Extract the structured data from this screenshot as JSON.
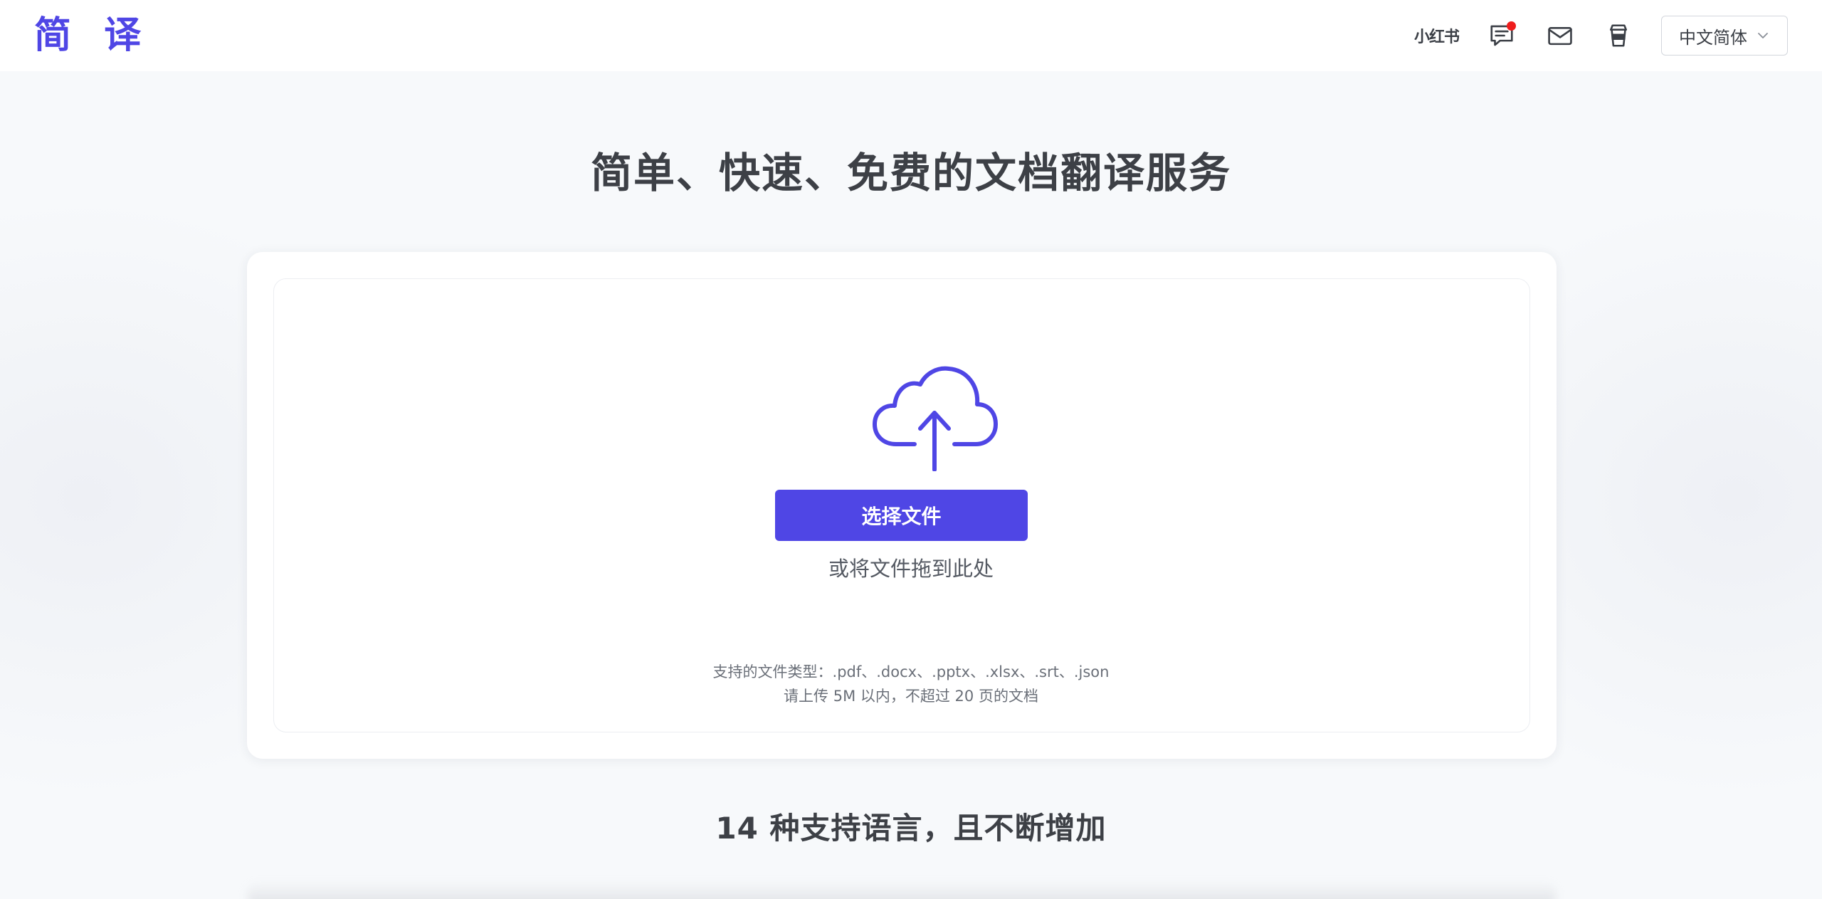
{
  "header": {
    "logo": "简 译",
    "xiaohongshu": "小红书",
    "icons": [
      "feedback-icon",
      "mail-icon",
      "coffee-icon"
    ],
    "language": "中文简体"
  },
  "hero": {
    "title": "简单、快速、免费的文档翻译服务"
  },
  "upload": {
    "button_label": "选择文件",
    "drag_hint": "或将文件拖到此处",
    "supported_types": "支持的文件类型：.pdf、.docx、.pptx、.xlsx、.srt、.json",
    "limit": "请上传 5M 以内，不超过 20 页的文档"
  },
  "languages_section": {
    "title": "14 种支持语言，且不断增加"
  },
  "colors": {
    "accent": "#4f46e5",
    "badge": "#ef1d1d"
  }
}
